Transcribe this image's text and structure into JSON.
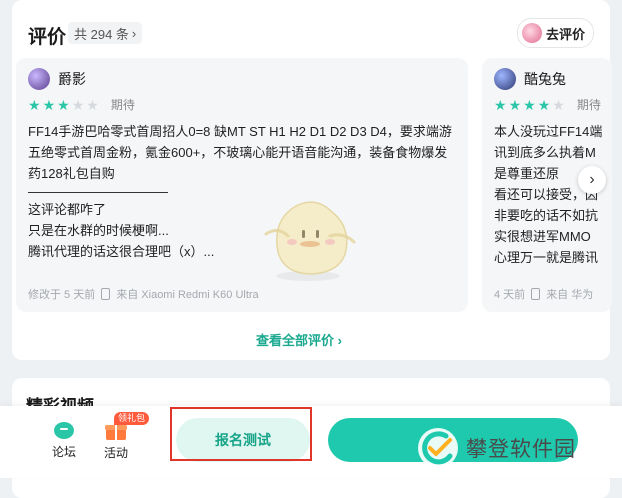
{
  "reviews_section": {
    "title": "评价",
    "count_label": "共 294 条",
    "count_chevron": "›",
    "go_review_label": "去评价",
    "view_all_label": "查看全部评价 ›",
    "next_arrow": "›"
  },
  "reviews": [
    {
      "username": "爵影",
      "rating": 3,
      "rating_max": 5,
      "rating_text": "期待",
      "body_part1": "FF14手游巴哈零式首周招人0=8 缺MT ST H1 H2 D1 D2 D3 D4，要求端游五绝零式首周金粉，氪金600+，不玻璃心能开语音能沟通，装备食物爆发药128礼包自购",
      "body_part2": "这评论都咋了\n只是在水群的时候梗啊...\n腾讯代理的话这很合理吧（x）...",
      "footer_time": "修改于 5 天前",
      "footer_device": "来自 Xiaomi Redmi K60 Ultra"
    },
    {
      "username": "酷兔兔",
      "rating": 4,
      "rating_max": 5,
      "rating_text": "期待",
      "body": "本人没玩过FF14端\n讯到底多么执着M\n是尊重还原\n看还可以接受，因\n非要吃的话不如抗\n实很想进军MMO\n心理万一就是腾讯",
      "footer_time": "4 天前",
      "footer_device": "来自 华为"
    }
  ],
  "video_section": {
    "title": "精彩视频"
  },
  "bottom_bar": {
    "forum_label": "论坛",
    "activity_label": "活动",
    "gift_badge": "领礼包",
    "signup_label": "报名测试"
  },
  "watermark": {
    "text": "攀登软件园"
  },
  "colors": {
    "accent": "#1ec9ad",
    "star_on": "#2bc6a8",
    "highlight": "#e0362a"
  }
}
